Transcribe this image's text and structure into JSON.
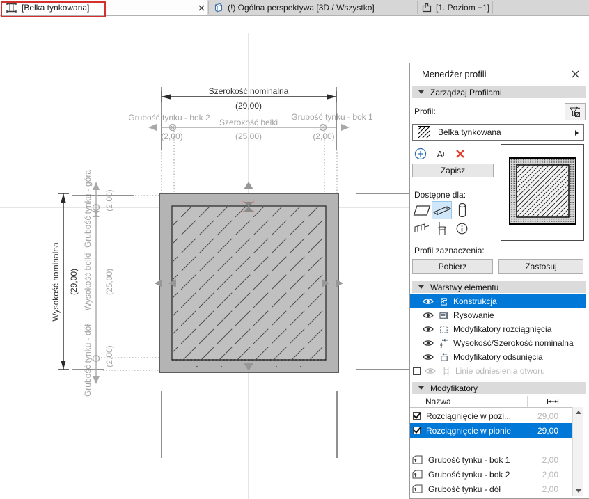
{
  "tabbar": {
    "tabs": [
      {
        "label": "[Belka tynkowana]"
      },
      {
        "label": "(!) Ogólna perspektywa [3D / Wszystko]"
      },
      {
        "label": "[1. Poziom +1]"
      }
    ]
  },
  "drawing": {
    "h_nominal": {
      "label": "Szerokość nominalna",
      "value": "(29,00)"
    },
    "h_plaster2": {
      "label": "Grubość tynku - bok 2",
      "value": "(2,00)"
    },
    "h_beam": {
      "label": "Szerokość belki",
      "value": "(25,00)"
    },
    "h_plaster1": {
      "label": "Grubość tynku - bok 1",
      "value": "(2,00)"
    },
    "v_nominal": {
      "label": "Wysokość nominalna",
      "value": "(29,00)"
    },
    "v_plaster_top": {
      "label": "Grubość tynku - góra",
      "value": "(2,00)"
    },
    "v_beam": {
      "label": "Wysokość belki",
      "value": "(25,00)"
    },
    "v_plaster_bot": {
      "label": "Grubość tynku - dół",
      "value": "(2,00)"
    }
  },
  "panel": {
    "title": "Menedżer profili",
    "manage_header": "Zarządzaj Profilami",
    "profile_label": "Profil:",
    "profile_name": "Belka tynkowana",
    "rename_main": "A",
    "rename_sup": "I",
    "save": "Zapisz",
    "available_for": "Dostępne dla:",
    "selection_label": "Profil zaznaczenia:",
    "pick": "Pobierz",
    "apply": "Zastosuj",
    "layers_header": "Warstwy elementu",
    "layers": [
      {
        "label": "Konstrukcja",
        "selected": true
      },
      {
        "label": "Rysowanie"
      },
      {
        "label": "Modyfikatory rozciągnięcia"
      },
      {
        "label": "Wysokość/Szerokość nominalna"
      },
      {
        "label": "Modyfikatory odsunięcia"
      },
      {
        "label": "Linie odniesienia otworu",
        "disabled": true
      }
    ],
    "modifiers_header": "Modyfikatory",
    "table": {
      "name_header": "Nazwa",
      "rows": [
        {
          "label": "Rozciągnięcie w pozi...",
          "value": "29,00",
          "checked": true
        },
        {
          "label": "Rozciągnięcie w pionie",
          "value": "29,00",
          "checked": true,
          "selected": true
        },
        {
          "label": "Grubość tynku - bok 1",
          "value": "2,00"
        },
        {
          "label": "Grubość tynku - bok 2",
          "value": "2,00"
        },
        {
          "label": "Grubość tynku - dół",
          "value": "2,00"
        }
      ]
    }
  },
  "colors": {
    "selection_blue": "#0078d7",
    "highlight_red": "#d42f2f",
    "beam_fill": "#b4b4b4",
    "core_fill": "#c0c0c0",
    "dim_gray": "#a3a3a3"
  }
}
